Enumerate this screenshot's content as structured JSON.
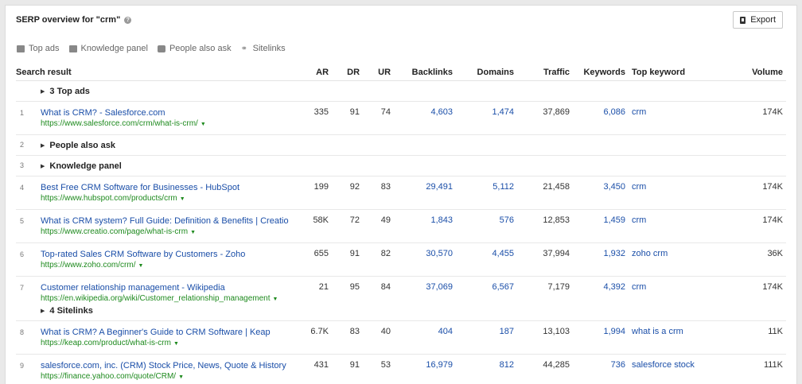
{
  "title": "SERP overview for \"crm\"",
  "export_label": "Export",
  "filters": [
    {
      "label": "Top ads",
      "icon": "ad-icon"
    },
    {
      "label": "Knowledge panel",
      "icon": "panel-icon"
    },
    {
      "label": "People also ask",
      "icon": "chat-icon"
    },
    {
      "label": "Sitelinks",
      "icon": "link-icon"
    }
  ],
  "columns": {
    "search_result": "Search result",
    "ar": "AR",
    "dr": "DR",
    "ur": "UR",
    "backlinks": "Backlinks",
    "domains": "Domains",
    "traffic": "Traffic",
    "keywords": "Keywords",
    "top_keyword": "Top keyword",
    "volume": "Volume"
  },
  "top_ads_group": {
    "label": "3 Top ads"
  },
  "rows": [
    {
      "pos": "1",
      "title": "What is CRM? - Salesforce.com",
      "url": "https://www.salesforce.com/crm/what-is-crm/",
      "ar": "335",
      "dr": "91",
      "ur": "74",
      "backlinks": "4,603",
      "domains": "1,474",
      "traffic": "37,869",
      "keywords": "6,086",
      "top_keyword": "crm",
      "volume": "174K"
    },
    {
      "pos": "4",
      "title": "Best Free CRM Software for Businesses - HubSpot",
      "url": "https://www.hubspot.com/products/crm",
      "ar": "199",
      "dr": "92",
      "ur": "83",
      "backlinks": "29,491",
      "domains": "5,112",
      "traffic": "21,458",
      "keywords": "3,450",
      "top_keyword": "crm",
      "volume": "174K"
    },
    {
      "pos": "5",
      "title": "What is CRM system? Full Guide: Definition & Benefits | Creatio",
      "url": "https://www.creatio.com/page/what-is-crm",
      "ar": "58K",
      "dr": "72",
      "ur": "49",
      "backlinks": "1,843",
      "domains": "576",
      "traffic": "12,853",
      "keywords": "1,459",
      "top_keyword": "crm",
      "volume": "174K"
    },
    {
      "pos": "6",
      "title": "Top-rated Sales CRM Software by Customers - Zoho",
      "url": "https://www.zoho.com/crm/",
      "ar": "655",
      "dr": "91",
      "ur": "82",
      "backlinks": "30,570",
      "domains": "4,455",
      "traffic": "37,994",
      "keywords": "1,932",
      "top_keyword": "zoho crm",
      "volume": "36K"
    },
    {
      "pos": "7",
      "title": "Customer relationship management - Wikipedia",
      "url": "https://en.wikipedia.org/wiki/Customer_relationship_management",
      "ar": "21",
      "dr": "95",
      "ur": "84",
      "backlinks": "37,069",
      "domains": "6,567",
      "traffic": "7,179",
      "keywords": "4,392",
      "top_keyword": "crm",
      "volume": "174K"
    },
    {
      "pos": "8",
      "title": "What is CRM? A Beginner's Guide to CRM Software | Keap",
      "url": "https://keap.com/product/what-is-crm",
      "ar": "6.7K",
      "dr": "83",
      "ur": "40",
      "backlinks": "404",
      "domains": "187",
      "traffic": "13,103",
      "keywords": "1,994",
      "top_keyword": "what is a crm",
      "volume": "11K"
    },
    {
      "pos": "9",
      "title": "salesforce.com, inc. (CRM) Stock Price, News, Quote & History",
      "url": "https://finance.yahoo.com/quote/CRM/",
      "ar": "431",
      "dr": "91",
      "ur": "53",
      "backlinks": "16,979",
      "domains": "812",
      "traffic": "44,285",
      "keywords": "736",
      "top_keyword": "salesforce stock",
      "volume": "111K"
    }
  ],
  "groups": {
    "people_also_ask": {
      "pos": "2",
      "label": "People also ask"
    },
    "knowledge_panel": {
      "pos": "3",
      "label": "Knowledge panel"
    },
    "sitelinks": {
      "label": "4 Sitelinks"
    }
  }
}
